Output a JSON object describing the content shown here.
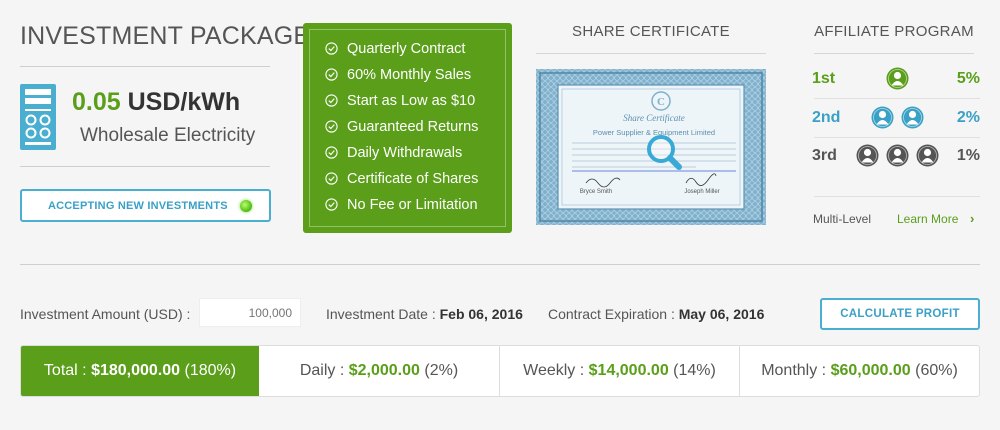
{
  "package": {
    "title": "INVESTMENT PACKAGE",
    "price_value": "0.05",
    "price_unit": "USD/kWh",
    "subtitle": "Wholesale Electricity",
    "accept_button": "ACCEPTING NEW INVESTMENTS"
  },
  "features": [
    "Quarterly Contract",
    "60% Monthly Sales",
    "Start as Low as $10",
    "Guaranteed Returns",
    "Daily Withdrawals",
    "Certificate of Shares",
    "No Fee or Limitation"
  ],
  "certificate": {
    "title": "SHARE CERTIFICATE",
    "heading": "Share Certificate",
    "company": "Power Supplier & Equipment Limited",
    "signer_left": "Bryce Smith",
    "signer_right": "Joseph Miller"
  },
  "affiliate": {
    "title": "AFFILIATE PROGRAM",
    "levels": [
      {
        "rank": "1st",
        "percent": "5%",
        "color": "#5a9e1a",
        "people": 1
      },
      {
        "rank": "2nd",
        "percent": "2%",
        "color": "#3aa0c6",
        "people": 2
      },
      {
        "rank": "3rd",
        "percent": "1%",
        "color": "#555555",
        "people": 3
      }
    ],
    "multi_level": "Multi-Level",
    "learn_more": "Learn More",
    "arrow": "›"
  },
  "calculator": {
    "amount_label": "Investment Amount (USD) :",
    "amount_placeholder": "100,000",
    "date_label": "Investment Date :",
    "date_value": "Feb 06, 2016",
    "expiry_label": "Contract Expiration :",
    "expiry_value": "May 06, 2016",
    "calculate_button": "CALCULATE PROFIT"
  },
  "totals": [
    {
      "label": "Total :",
      "value": "$180,000.00",
      "pct": "(180%)"
    },
    {
      "label": "Daily :",
      "value": "$2,000.00",
      "pct": "(2%)"
    },
    {
      "label": "Weekly :",
      "value": "$14,000.00",
      "pct": "(14%)"
    },
    {
      "label": "Monthly :",
      "value": "$60,000.00",
      "pct": "(60%)"
    }
  ],
  "colors": {
    "green": "#5a9e1a",
    "blue": "#3aa0c6",
    "gray": "#555555"
  }
}
